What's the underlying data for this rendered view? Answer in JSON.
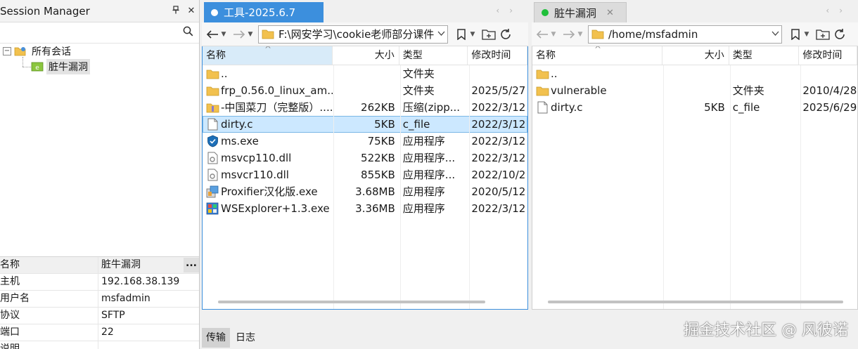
{
  "session": {
    "title": "Session Manager",
    "pin_icon": "pin-icon",
    "close_icon": "close-icon",
    "search_icon": "search-icon",
    "tree": [
      {
        "label": "所有会话",
        "icon": "folder-group-icon",
        "expanded": true
      },
      {
        "label": "脏牛漏洞",
        "icon": "session-icon",
        "selected": true
      }
    ],
    "tree_expander": "−",
    "props": [
      {
        "key": "名称",
        "value": "脏牛漏洞",
        "has_more": true
      },
      {
        "key": "主机",
        "value": "192.168.38.139"
      },
      {
        "key": "用户名",
        "value": "msfadmin"
      },
      {
        "key": "协议",
        "value": "SFTP"
      },
      {
        "key": "端口",
        "value": "22"
      },
      {
        "key": "说明",
        "value": ""
      }
    ],
    "more_label": "..."
  },
  "left": {
    "tab_title": "工具-2025.6.7",
    "tab_dot_color": "#ffffff",
    "path": "F:\\网安学习\\cookie老师部分课件",
    "columns": {
      "name": "名称",
      "size": "大小",
      "type": "类型",
      "modified": "修改时间"
    },
    "files": [
      {
        "name": "..",
        "size": "",
        "type": "文件夹",
        "modified": "",
        "icon": "folder-icon"
      },
      {
        "name": "frp_0.56.0_linux_am...",
        "size": "",
        "type": "文件夹",
        "modified": "2025/5/27",
        "icon": "folder-icon"
      },
      {
        "name": "-中国菜刀（完整版）....",
        "size": "262KB",
        "type": "压缩(zipp...",
        "modified": "2022/3/12",
        "icon": "zip-folder-icon"
      },
      {
        "name": "dirty.c",
        "size": "5KB",
        "type": "c_file",
        "modified": "2022/3/12",
        "icon": "file-icon",
        "selected": true
      },
      {
        "name": "ms.exe",
        "size": "75KB",
        "type": "应用程序",
        "modified": "2022/3/12",
        "icon": "shield-exe-icon"
      },
      {
        "name": "msvcp110.dll",
        "size": "522KB",
        "type": "应用程序...",
        "modified": "2022/3/12",
        "icon": "dll-icon"
      },
      {
        "name": "msvcr110.dll",
        "size": "855KB",
        "type": "应用程序...",
        "modified": "2022/10/2",
        "icon": "dll-icon"
      },
      {
        "name": "Proxifier汉化版.exe",
        "size": "3.68MB",
        "type": "应用程序",
        "modified": "2020/5/12",
        "icon": "installer-exe-icon"
      },
      {
        "name": "WSExplorer+1.3.exe",
        "size": "3.36MB",
        "type": "应用程序",
        "modified": "2022/3/12",
        "icon": "app-exe-icon"
      }
    ]
  },
  "right": {
    "tab_title": "脏牛漏洞",
    "tab_dot_color": "#1fbf3a",
    "path": "/home/msfadmin",
    "columns": {
      "name": "名称",
      "size": "大小",
      "type": "类型",
      "modified": "修改时间"
    },
    "files": [
      {
        "name": "..",
        "size": "",
        "type": "",
        "modified": "",
        "icon": "folder-icon"
      },
      {
        "name": "vulnerable",
        "size": "",
        "type": "文件夹",
        "modified": "2010/4/28",
        "icon": "folder-icon"
      },
      {
        "name": "dirty.c",
        "size": "5KB",
        "type": "c_file",
        "modified": "2025/6/29",
        "icon": "file-icon"
      }
    ]
  },
  "bottom": {
    "tabs": [
      {
        "label": "传输",
        "active": true
      },
      {
        "label": "日志",
        "active": false
      }
    ]
  },
  "watermark": "掘金技术社区 @ 风彼诺",
  "colors": {
    "accent": "#3c8fdd",
    "selection": "#cce8ff",
    "folder": "#f2c14e",
    "connected": "#1fbf3a"
  }
}
